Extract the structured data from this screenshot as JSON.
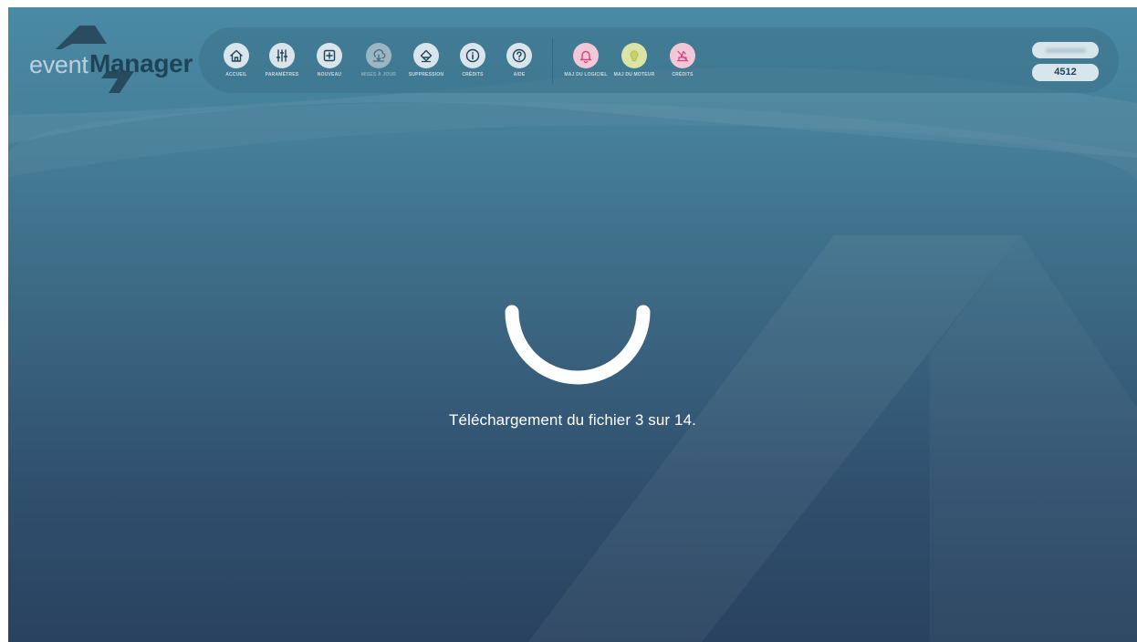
{
  "app": {
    "logo_word_event": "event",
    "logo_word_manager": "Manager"
  },
  "toolbar": {
    "buttons": [
      {
        "label": "ACCUEIL",
        "icon": "home-icon"
      },
      {
        "label": "PARAMÈTRES",
        "icon": "sliders-icon"
      },
      {
        "label": "NOUVEAU",
        "icon": "plus-square-icon"
      },
      {
        "label": "MISES À JOUR",
        "icon": "update-download-icon",
        "state": "disabled"
      },
      {
        "label": "SUPPRESSION",
        "icon": "eraser-icon"
      },
      {
        "label": "CRÉDITS",
        "icon": "info-icon"
      },
      {
        "label": "AIDE",
        "icon": "help-icon"
      },
      {
        "label": "MAJ DU LOGICIEL",
        "icon": "bell-icon"
      },
      {
        "label": "MAJ DU MOTEUR",
        "icon": "lightbulb-icon"
      },
      {
        "label": "CRÉDITS",
        "icon": "credits-icon"
      }
    ]
  },
  "account": {
    "code": "4512"
  },
  "status": {
    "message": "Téléchargement du fichier 3 sur 14."
  },
  "colors": {
    "background_top": "#4a8aa4",
    "background_bottom": "#29425f",
    "dark_blue": "#1f4459",
    "pink_accent": "#d6457e",
    "yellow_accent": "#dbe3a5"
  }
}
